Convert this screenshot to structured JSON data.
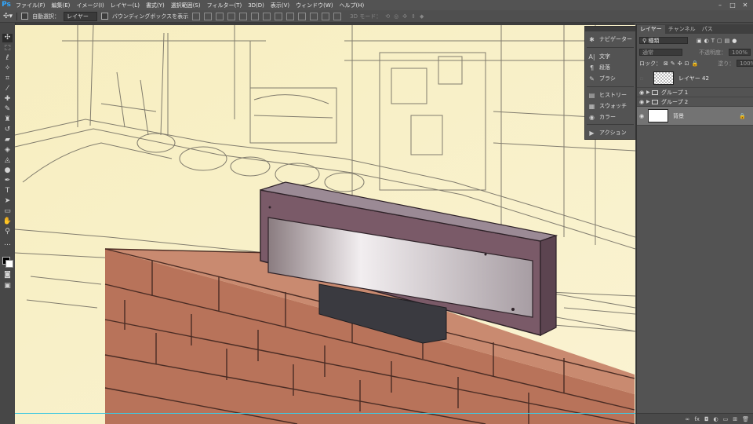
{
  "app": {
    "logo": "Ps"
  },
  "menu": [
    "ファイル(F)",
    "編集(E)",
    "イメージ(I)",
    "レイヤー(L)",
    "書式(Y)",
    "選択範囲(S)",
    "フィルター(T)",
    "3D(D)",
    "表示(V)",
    "ウィンドウ(W)",
    "ヘルプ(H)"
  ],
  "options": {
    "auto_select": "自動選択：",
    "target": "レイヤー",
    "bbox": "バウンディングボックスを表示",
    "mode_3d": "3D モード："
  },
  "float_panel": {
    "navigator": "ナビゲーター",
    "character": "文字",
    "paragraph": "段落",
    "brush": "ブラシ",
    "history": "ヒストリー",
    "swatches": "スウォッチ",
    "color": "カラー",
    "actions": "アクション"
  },
  "layers_panel": {
    "tabs": [
      "レイヤー",
      "チャンネル",
      "パス"
    ],
    "filter_kind": "種類",
    "blend_mode": "通常",
    "opacity_label": "不透明度：",
    "opacity_value": "100%",
    "lock_label": "ロック：",
    "fill_label": "塗り：",
    "fill_value": "100%",
    "layers": [
      {
        "name": "レイヤー 42",
        "visible": false
      },
      {
        "name": "グループ 1",
        "visible": true
      },
      {
        "name": "グループ 2",
        "visible": true
      },
      {
        "name": "背景",
        "visible": true,
        "selected": true,
        "locked": true
      }
    ]
  }
}
